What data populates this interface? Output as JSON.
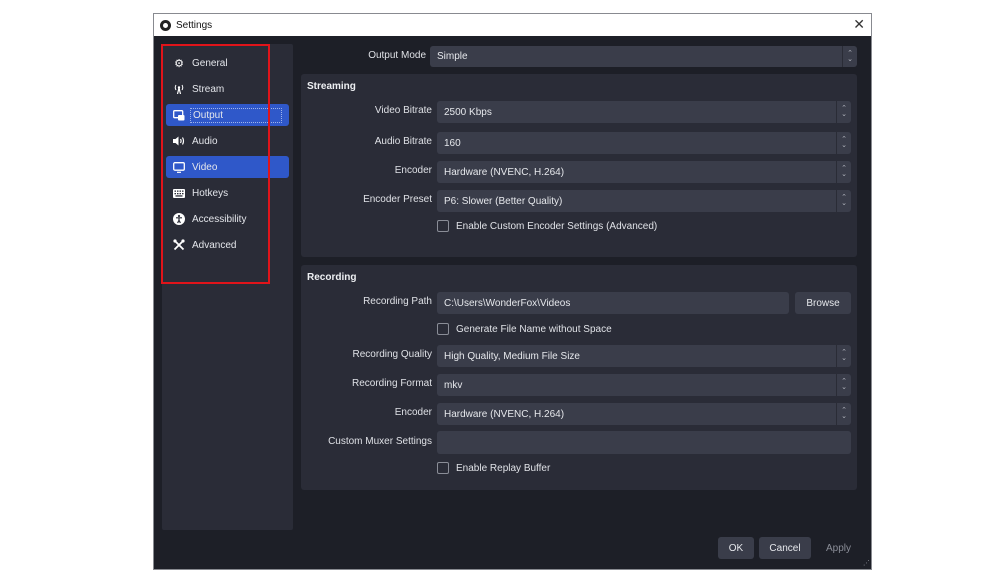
{
  "window": {
    "title": "Settings",
    "close_icon": "close-icon"
  },
  "sidebar": {
    "items": [
      {
        "label": "General",
        "icon": "gear-icon",
        "glyph": "⚙",
        "active": false
      },
      {
        "label": "Stream",
        "icon": "antenna-icon",
        "glyph": "⚲",
        "active": false
      },
      {
        "label": "Output",
        "icon": "output-icon",
        "glyph": "▣",
        "active": true
      },
      {
        "label": "Audio",
        "icon": "speaker-icon",
        "glyph": "🔊",
        "active": false
      },
      {
        "label": "Video",
        "icon": "monitor-icon",
        "glyph": "▭",
        "active": true
      },
      {
        "label": "Hotkeys",
        "icon": "keyboard-icon",
        "glyph": "⌨",
        "active": false
      },
      {
        "label": "Accessibility",
        "icon": "accessibility-icon",
        "glyph": "♿",
        "active": false
      },
      {
        "label": "Advanced",
        "icon": "tools-icon",
        "glyph": "✂",
        "active": false
      }
    ]
  },
  "output_mode": {
    "label": "Output Mode",
    "value": "Simple"
  },
  "streaming": {
    "title": "Streaming",
    "video_bitrate": {
      "label": "Video Bitrate",
      "value": "2500 Kbps"
    },
    "audio_bitrate": {
      "label": "Audio Bitrate",
      "value": "160"
    },
    "encoder": {
      "label": "Encoder",
      "value": "Hardware (NVENC, H.264)"
    },
    "encoder_preset": {
      "label": "Encoder Preset",
      "value": "P6: Slower (Better Quality)"
    },
    "custom_encoder_checkbox": {
      "label": "Enable Custom Encoder Settings (Advanced)",
      "checked": false
    }
  },
  "recording": {
    "title": "Recording",
    "path": {
      "label": "Recording Path",
      "value": "C:\\Users\\WonderFox\\Videos"
    },
    "browse_label": "Browse",
    "no_space_checkbox": {
      "label": "Generate File Name without Space",
      "checked": false
    },
    "quality": {
      "label": "Recording Quality",
      "value": "High Quality, Medium File Size"
    },
    "format": {
      "label": "Recording Format",
      "value": "mkv"
    },
    "encoder": {
      "label": "Encoder",
      "value": "Hardware (NVENC, H.264)"
    },
    "muxer": {
      "label": "Custom Muxer Settings",
      "value": ""
    },
    "replay_checkbox": {
      "label": "Enable Replay Buffer",
      "checked": false
    }
  },
  "footer": {
    "ok_label": "OK",
    "cancel_label": "Cancel",
    "apply_label": "Apply"
  },
  "colors": {
    "accent": "#2f58c9",
    "highlight_frame": "#e0141a",
    "background": "#1d1f27",
    "panel": "#2a2c37",
    "field": "#3a3d4a"
  }
}
